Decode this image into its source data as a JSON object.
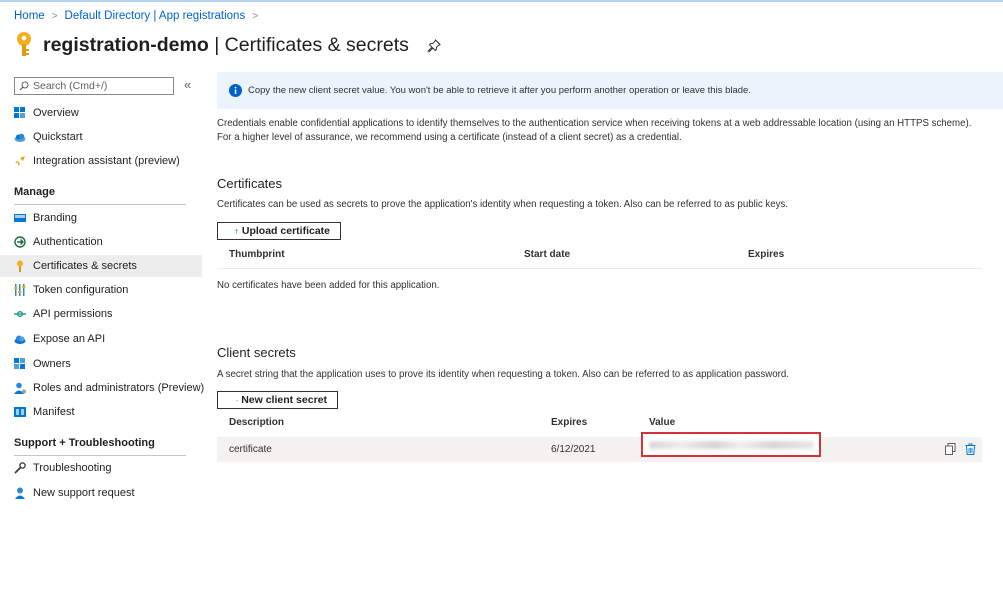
{
  "breadcrumb": {
    "items": [
      "Home",
      "Default Directory | App registrations"
    ]
  },
  "header": {
    "title_bold": "registration-demo",
    "title_rest": " | Certificates & secrets"
  },
  "sidebar": {
    "search_placeholder": "Search (Cmd+/)",
    "collapse_glyph": "«",
    "top_items": [
      {
        "label": "Overview"
      },
      {
        "label": "Quickstart"
      },
      {
        "label": "Integration assistant (preview)"
      }
    ],
    "manage_heading": "Manage",
    "manage_items": [
      {
        "label": "Branding"
      },
      {
        "label": "Authentication"
      },
      {
        "label": "Certificates & secrets"
      },
      {
        "label": "Token configuration"
      },
      {
        "label": "API permissions"
      },
      {
        "label": "Expose an API"
      },
      {
        "label": "Owners"
      },
      {
        "label": "Roles and administrators (Preview)"
      },
      {
        "label": "Manifest"
      }
    ],
    "support_heading": "Support + Troubleshooting",
    "support_items": [
      {
        "label": "Troubleshooting"
      },
      {
        "label": "New support request"
      }
    ]
  },
  "info_bar": {
    "text": "Copy the new client secret value. You won't be able to retrieve it after you perform another operation or leave this blade."
  },
  "intro": "Credentials enable confidential applications to identify themselves to the authentication service when receiving tokens at a web addressable location (using an HTTPS scheme). For a higher level of assurance, we recommend using a certificate (instead of a client secret) as a credential.",
  "certificates": {
    "heading": "Certificates",
    "description": "Certificates can be used as secrets to prove the application's identity when requesting a token. Also can be referred to as public keys.",
    "upload_label": "Upload certificate",
    "columns": [
      "Thumbprint",
      "Start date",
      "Expires"
    ],
    "empty_text": "No certificates have been added for this application."
  },
  "client_secrets": {
    "heading": "Client secrets",
    "description": "A secret string that the application uses to prove its identity when requesting a token. Also can be referred to as application password.",
    "new_label": "New client secret",
    "columns": [
      "Description",
      "Expires",
      "Value"
    ],
    "rows": [
      {
        "description": "certificate",
        "expires": "6/12/2021"
      }
    ]
  },
  "colors": {
    "link": "#0062c9",
    "info_bg": "#ebf3fc",
    "highlight_border": "#d13438",
    "active_nav_bg": "#ededed"
  },
  "icons": {
    "page": "key-icon",
    "pin": "pin-icon",
    "info": "info-icon",
    "copy": "copy-icon",
    "delete": "trash-icon"
  }
}
